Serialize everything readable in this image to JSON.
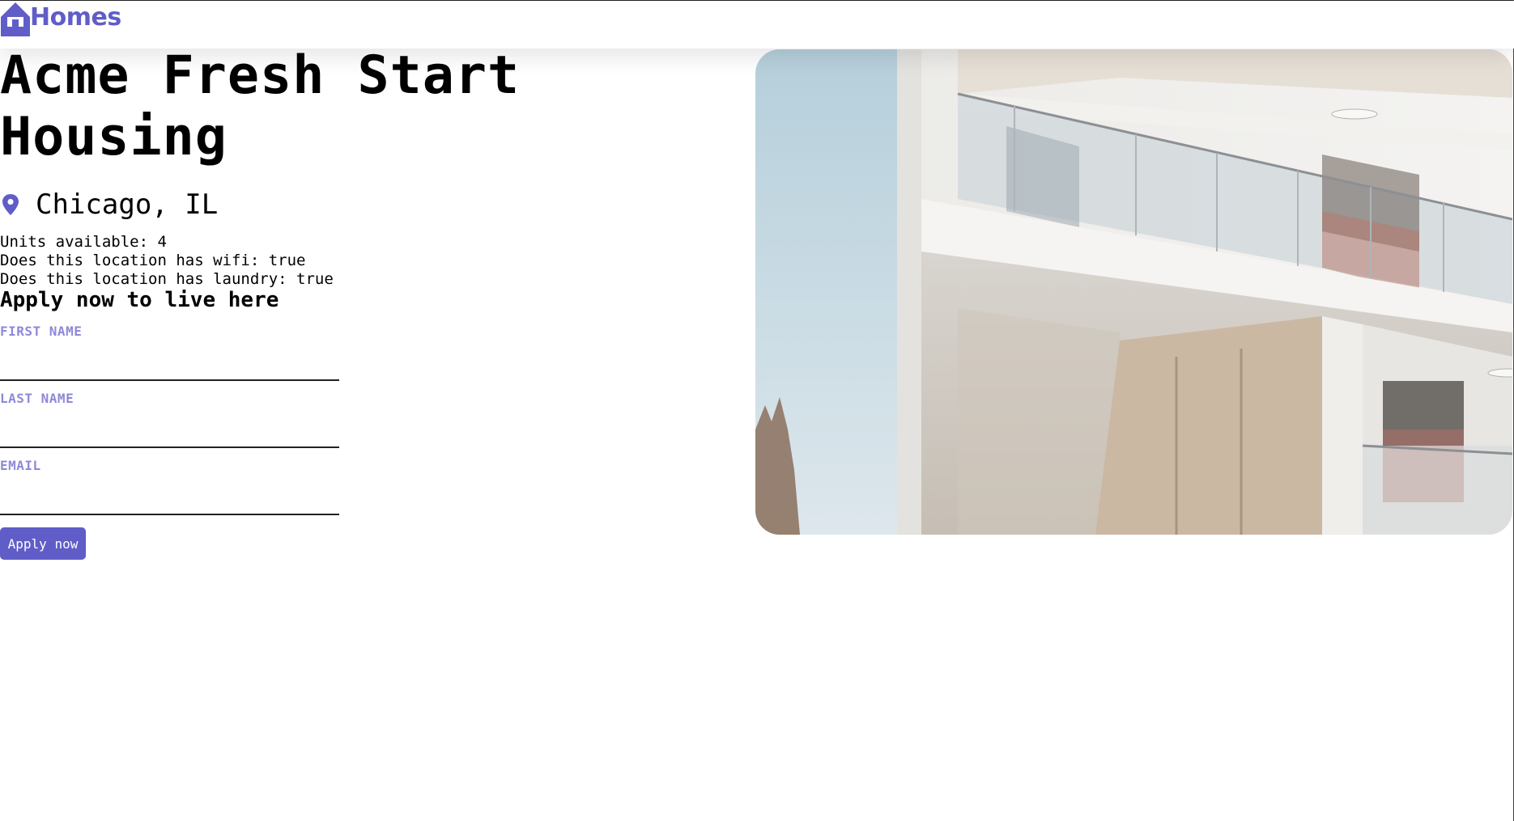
{
  "header": {
    "logo_text": "Homes",
    "logo_icon": "house-icon",
    "brand_color": "#605DC8"
  },
  "listing": {
    "name": "Acme Fresh Start Housing",
    "location_icon": "location-pin-icon",
    "location": "Chicago, IL",
    "units_line": "Units available: 4",
    "wifi_line": "Does this location has wifi: true",
    "laundry_line": "Does this location has laundry: true",
    "photo": "building-photo"
  },
  "application": {
    "heading": "Apply now to live here",
    "first_name_label": "FIRST NAME",
    "first_name_value": "",
    "last_name_label": "LAST NAME",
    "last_name_value": "",
    "email_label": "EMAIL",
    "email_value": "",
    "submit_label": "Apply now",
    "label_color": "#8d89d8"
  }
}
